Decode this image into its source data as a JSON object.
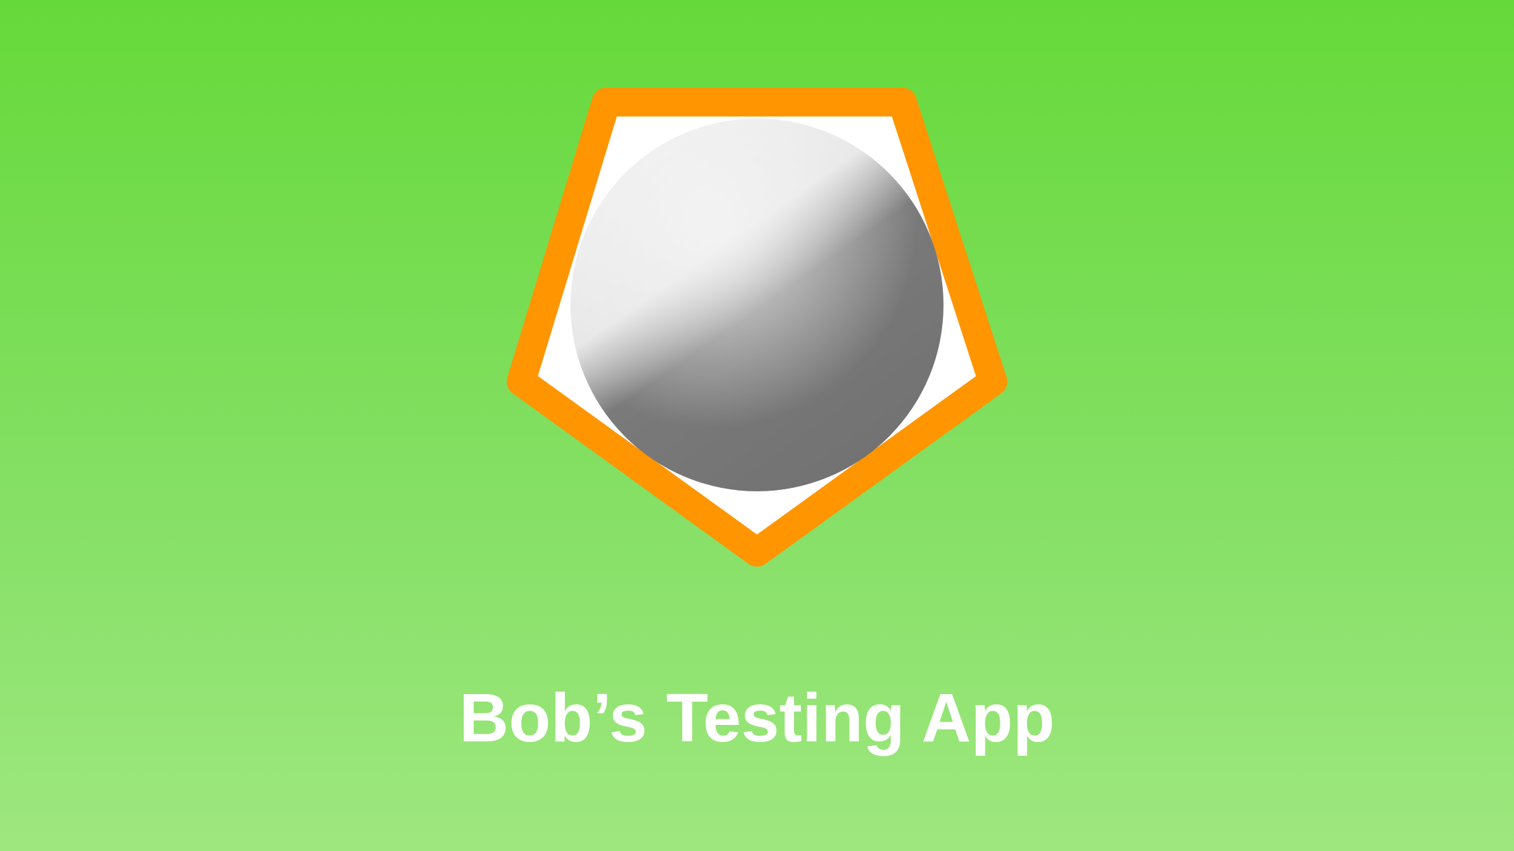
{
  "splash": {
    "app_title": "Bob’s Testing App"
  },
  "logo": {
    "shape": "pentagon-with-sphere",
    "icon_name": "app-logo-icon"
  },
  "colors": {
    "background_top": "#66d93a",
    "background_bottom": "#9ee77f",
    "pentagon_stroke": "#ff9500",
    "pentagon_fill": "#ffffff",
    "sphere_light": "#f0f0f0",
    "sphere_dark": "#727272",
    "title_text": "#ffffff"
  }
}
